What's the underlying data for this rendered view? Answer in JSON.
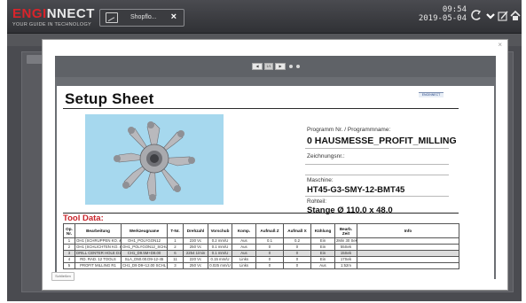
{
  "header": {
    "logo_red": "ENGI",
    "logo_rest": "NNECT",
    "logo_tagline": "YOUR GUIDE IN TECHNOLOGY",
    "tab_label": "Shopflo...",
    "tab_close": "×",
    "time": "09:54",
    "date": "2019-05-04",
    "icons": [
      "refresh-icon",
      "chevron-down-icon",
      "edit-icon",
      "home-icon"
    ]
  },
  "modal": {
    "title": "",
    "close": "×",
    "status_button": "Schließen"
  },
  "viewer": {
    "page_input": "1/1"
  },
  "sheet": {
    "title": "Setup Sheet",
    "brand": "ENGINNECT",
    "programm_label": "Programm Nr. / Programmname:",
    "programm_value": "0 HAUSMESSE_PROFIT_MILLING",
    "zeichnung_label": "Zeichnungsnr.:",
    "maschine_label": "Maschine:",
    "maschine_value": "HT45-G3-SMY-12-BMT45",
    "rohteil_label": "Rohteil:",
    "rohteil_value": "Stange Ø 110.0 x  48.0",
    "tool_data_label": "Tool Data:"
  },
  "tool_table": {
    "headers": [
      "Op. Nr.",
      "Bearbeitung",
      "Werkzeugname",
      "T-Nr.",
      "Drehzahl",
      "Vorschub",
      "Komp.",
      "Aufmaß Z",
      "Aufmaß X",
      "Kühlung",
      "Bearb. Zeit",
      "Info"
    ],
    "rows": [
      [
        "1",
        "OH1 (SCHRUPPEN KO. & PLAN)",
        "OH1_POLYGON12",
        "1",
        "230 Vc",
        "0.2 mm/U",
        "Aus",
        "0.1",
        "0.2",
        "Ein",
        "2Min 30 Sek",
        ""
      ],
      [
        "2",
        "OH1 (SCHLICHTEN KO. & PLAN)",
        "OH1_POLYGON12_SCHL",
        "2",
        "250 Vc",
        "0.1 mm/U",
        "Aus",
        "0",
        "0",
        "Ein",
        "55Sek",
        ""
      ],
      [
        "3",
        "DRILL CENTER HOLE D10.00",
        "CH1_D9.5M+D8.00",
        "6",
        "2254 1/min",
        "0.1 mm/U",
        "Aus",
        "0",
        "0",
        "Ein",
        "15Sek",
        ""
      ],
      [
        "4",
        "RD. RAD. 12 TOOLS",
        "SLA_D50.00.D9-12-45",
        "11",
        "220 Vc",
        "0.15 mm/U",
        "Links",
        "0",
        "0",
        "Ein",
        "17Sek",
        ""
      ],
      [
        "5",
        "PROFIT MILLING R1",
        "CH1_D9 D9+12.00 SCHL",
        "3",
        "250 Vc",
        "0.025 mm/U",
        "Links",
        "0",
        "0",
        "Aus",
        "1:52m",
        ""
      ]
    ]
  },
  "colors": {
    "accent_red": "#d8242b",
    "toolbar_dark": "#3a3b3f",
    "image_bg": "#a6d8ee"
  }
}
